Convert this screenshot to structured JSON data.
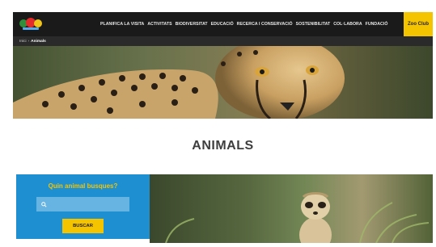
{
  "nav": {
    "logo_alt": "Zoo Barcelona",
    "items": [
      {
        "label": "PLANIFICA LA VISITA"
      },
      {
        "label": "ACTIVITATS"
      },
      {
        "label": "BIODIVERSITAT"
      },
      {
        "label": "EDUCACIÓ"
      },
      {
        "label": "RECERCA I CONSERVACIÓ"
      },
      {
        "label": "SOSTENIBILITAT"
      },
      {
        "label": "COL·LABORA"
      },
      {
        "label": "FUNDACIÓ"
      }
    ],
    "cta_label": "Zoo Club"
  },
  "breadcrumb": {
    "home": "Inici",
    "separator": "›",
    "current": "Animals"
  },
  "page": {
    "title": "ANIMALS"
  },
  "search": {
    "heading": "Quin animal busques?",
    "input_value": "",
    "button_label": "BUSCAR",
    "icon": "search-icon"
  },
  "colors": {
    "nav_bg": "#1a1a1a",
    "accent_yellow": "#f5c400",
    "search_panel_blue": "#1e8fd0",
    "title_gray": "#3e3e3e"
  }
}
